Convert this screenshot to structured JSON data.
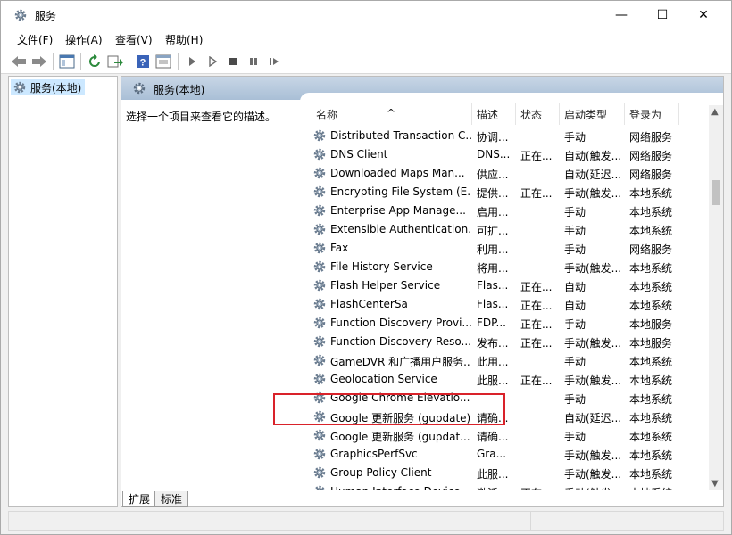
{
  "window": {
    "title": "服务",
    "icon": "gear-icon",
    "controls": {
      "minimize": "—",
      "maximize": "☐",
      "close": "✕"
    }
  },
  "menu": {
    "file": "文件(F)",
    "action": "操作(A)",
    "view": "查看(V)",
    "help": "帮助(H)"
  },
  "toolbar": {
    "icons": [
      "back-arrow-icon",
      "forward-arrow-icon",
      "console-tree-icon",
      "refresh-icon",
      "export-list-icon",
      "help-icon",
      "properties-icon",
      "start-service-icon",
      "start-service-alt-icon",
      "stop-service-icon",
      "pause-service-icon",
      "resume-service-icon"
    ]
  },
  "tree": {
    "item_label": "服务(本地)"
  },
  "pane": {
    "header_title": "服务(本地)",
    "description": "选择一个项目来查看它的描述。"
  },
  "columns": {
    "name": "名称",
    "desc": "描述",
    "status": "状态",
    "start_type": "启动类型",
    "logon": "登录为"
  },
  "rows": [
    {
      "name": "Distributed Transaction C...",
      "desc": "协调...",
      "status": "",
      "start": "手动",
      "logon": "网络服务"
    },
    {
      "name": "DNS Client",
      "desc": "DNS...",
      "status": "正在...",
      "start": "自动(触发...",
      "logon": "网络服务"
    },
    {
      "name": "Downloaded Maps Man...",
      "desc": "供应...",
      "status": "",
      "start": "自动(延迟...",
      "logon": "网络服务"
    },
    {
      "name": "Encrypting File System (E...",
      "desc": "提供...",
      "status": "正在...",
      "start": "手动(触发...",
      "logon": "本地系统"
    },
    {
      "name": "Enterprise App Manage...",
      "desc": "启用...",
      "status": "",
      "start": "手动",
      "logon": "本地系统"
    },
    {
      "name": "Extensible Authentication...",
      "desc": "可扩...",
      "status": "",
      "start": "手动",
      "logon": "本地系统"
    },
    {
      "name": "Fax",
      "desc": "利用...",
      "status": "",
      "start": "手动",
      "logon": "网络服务"
    },
    {
      "name": "File History Service",
      "desc": "将用...",
      "status": "",
      "start": "手动(触发...",
      "logon": "本地系统"
    },
    {
      "name": "Flash Helper Service",
      "desc": "Flas...",
      "status": "正在...",
      "start": "自动",
      "logon": "本地系统"
    },
    {
      "name": "FlashCenterSa",
      "desc": "Flas...",
      "status": "正在...",
      "start": "自动",
      "logon": "本地系统"
    },
    {
      "name": "Function Discovery Provi...",
      "desc": "FDP...",
      "status": "正在...",
      "start": "手动",
      "logon": "本地服务"
    },
    {
      "name": "Function Discovery Reso...",
      "desc": "发布...",
      "status": "正在...",
      "start": "手动(触发...",
      "logon": "本地服务"
    },
    {
      "name": "GameDVR 和广播用户服务...",
      "desc": "此用...",
      "status": "",
      "start": "手动",
      "logon": "本地系统"
    },
    {
      "name": "Geolocation Service",
      "desc": "此服...",
      "status": "正在...",
      "start": "手动(触发...",
      "logon": "本地系统"
    },
    {
      "name": "Google Chrome Elevatio...",
      "desc": "",
      "status": "",
      "start": "手动",
      "logon": "本地系统"
    },
    {
      "name": "Google 更新服务 (gupdate)",
      "desc": "请确...",
      "status": "",
      "start": "自动(延迟...",
      "logon": "本地系统"
    },
    {
      "name": "Google 更新服务 (gupdat...",
      "desc": "请确...",
      "status": "",
      "start": "手动",
      "logon": "本地系统"
    },
    {
      "name": "GraphicsPerfSvc",
      "desc": "Gra...",
      "status": "",
      "start": "手动(触发...",
      "logon": "本地系统"
    },
    {
      "name": "Group Policy Client",
      "desc": "此服...",
      "status": "",
      "start": "手动(触发...",
      "logon": "本地系统"
    },
    {
      "name": "Human Interface Device...",
      "desc": "激活...",
      "status": "正在...",
      "start": "手动(触发...",
      "logon": "本地系统"
    }
  ],
  "tabs": {
    "extended": "扩展",
    "standard": "标准"
  },
  "colors": {
    "highlight_border": "#d9222a",
    "selection": "#cce8ff",
    "pane_header": "#b6c9de"
  }
}
